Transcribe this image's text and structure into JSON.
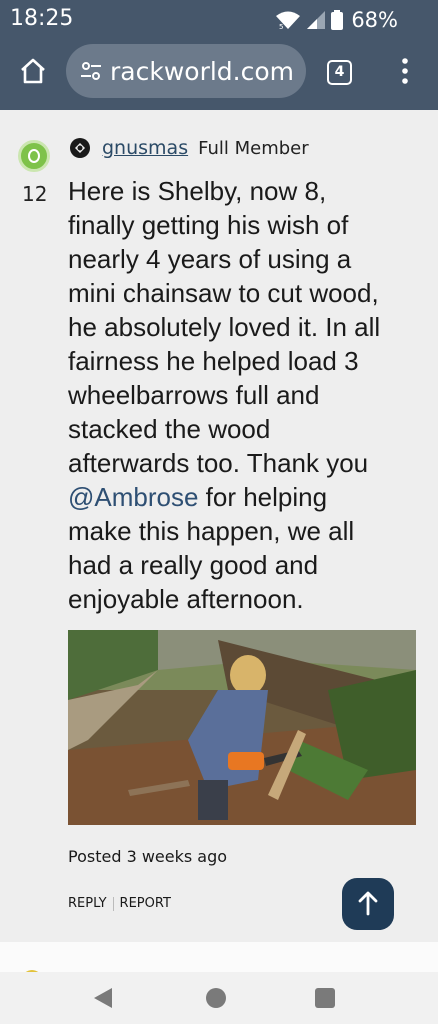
{
  "status_bar": {
    "time": "18:25",
    "battery": "68%",
    "icons": [
      "wifi-icon",
      "signal-icon",
      "battery-icon"
    ]
  },
  "browser": {
    "url": "rackworld.com",
    "tab_count": "4"
  },
  "post": {
    "username": "gnusmas",
    "rank": "Full Member",
    "vote_count": "12",
    "body_lines": [
      "Here is Shelby, now 8,",
      "finally getting his wish of",
      "nearly 4 years of using a",
      "mini chainsaw to cut wood,",
      "he absolutely loved it. In all",
      "fairness he helped load 3",
      "wheelbarrows full and",
      "stacked the wood",
      "afterwards too. Thank you"
    ],
    "mention": "@Ambrose",
    "body_after_mention": " for helping",
    "body_lines_2": [
      "make this happen, we all",
      "had a really good and",
      "enjoyable afternoon."
    ],
    "posted": "Posted 3 weeks ago",
    "actions": {
      "reply": "REPLY",
      "report": "REPORT"
    }
  },
  "colors": {
    "header_bg": "#46576b",
    "url_pill": "#6c7a8b",
    "link": "#2e4f73",
    "scroll_button": "#1f3b57",
    "avatar": "#7ec24a"
  }
}
